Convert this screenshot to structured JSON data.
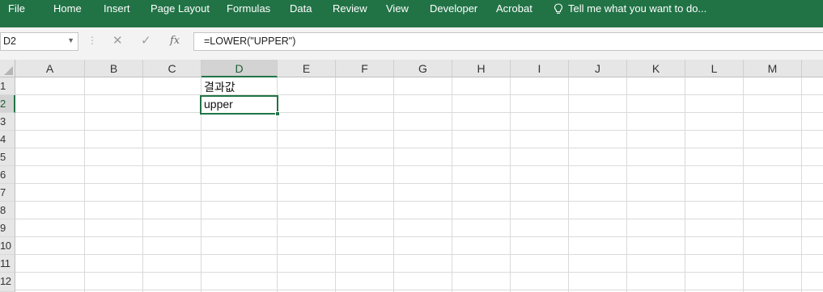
{
  "ribbon": {
    "tabs": [
      "File",
      "Home",
      "Insert",
      "Page Layout",
      "Formulas",
      "Data",
      "Review",
      "View",
      "Developer",
      "Acrobat"
    ],
    "tell_me_icon": "lightbulb-icon",
    "tell_me": "Tell me what you want to do..."
  },
  "formula_bar": {
    "name_box": "D2",
    "cancel_icon": "✕",
    "enter_icon": "✓",
    "fx_label": "fx",
    "formula": "=LOWER(\"UPPER\")"
  },
  "grid": {
    "columns": [
      "A",
      "B",
      "C",
      "D",
      "E",
      "F",
      "G",
      "H",
      "I",
      "J",
      "K",
      "L",
      "M"
    ],
    "rows": [
      "1",
      "2",
      "3",
      "4",
      "5",
      "6",
      "7",
      "8",
      "9",
      "10",
      "11",
      "12"
    ],
    "selected_column": "D",
    "selected_row": "2",
    "cells": {
      "D1": "결과값",
      "D2": "upper"
    }
  },
  "colors": {
    "accent": "#217346"
  }
}
